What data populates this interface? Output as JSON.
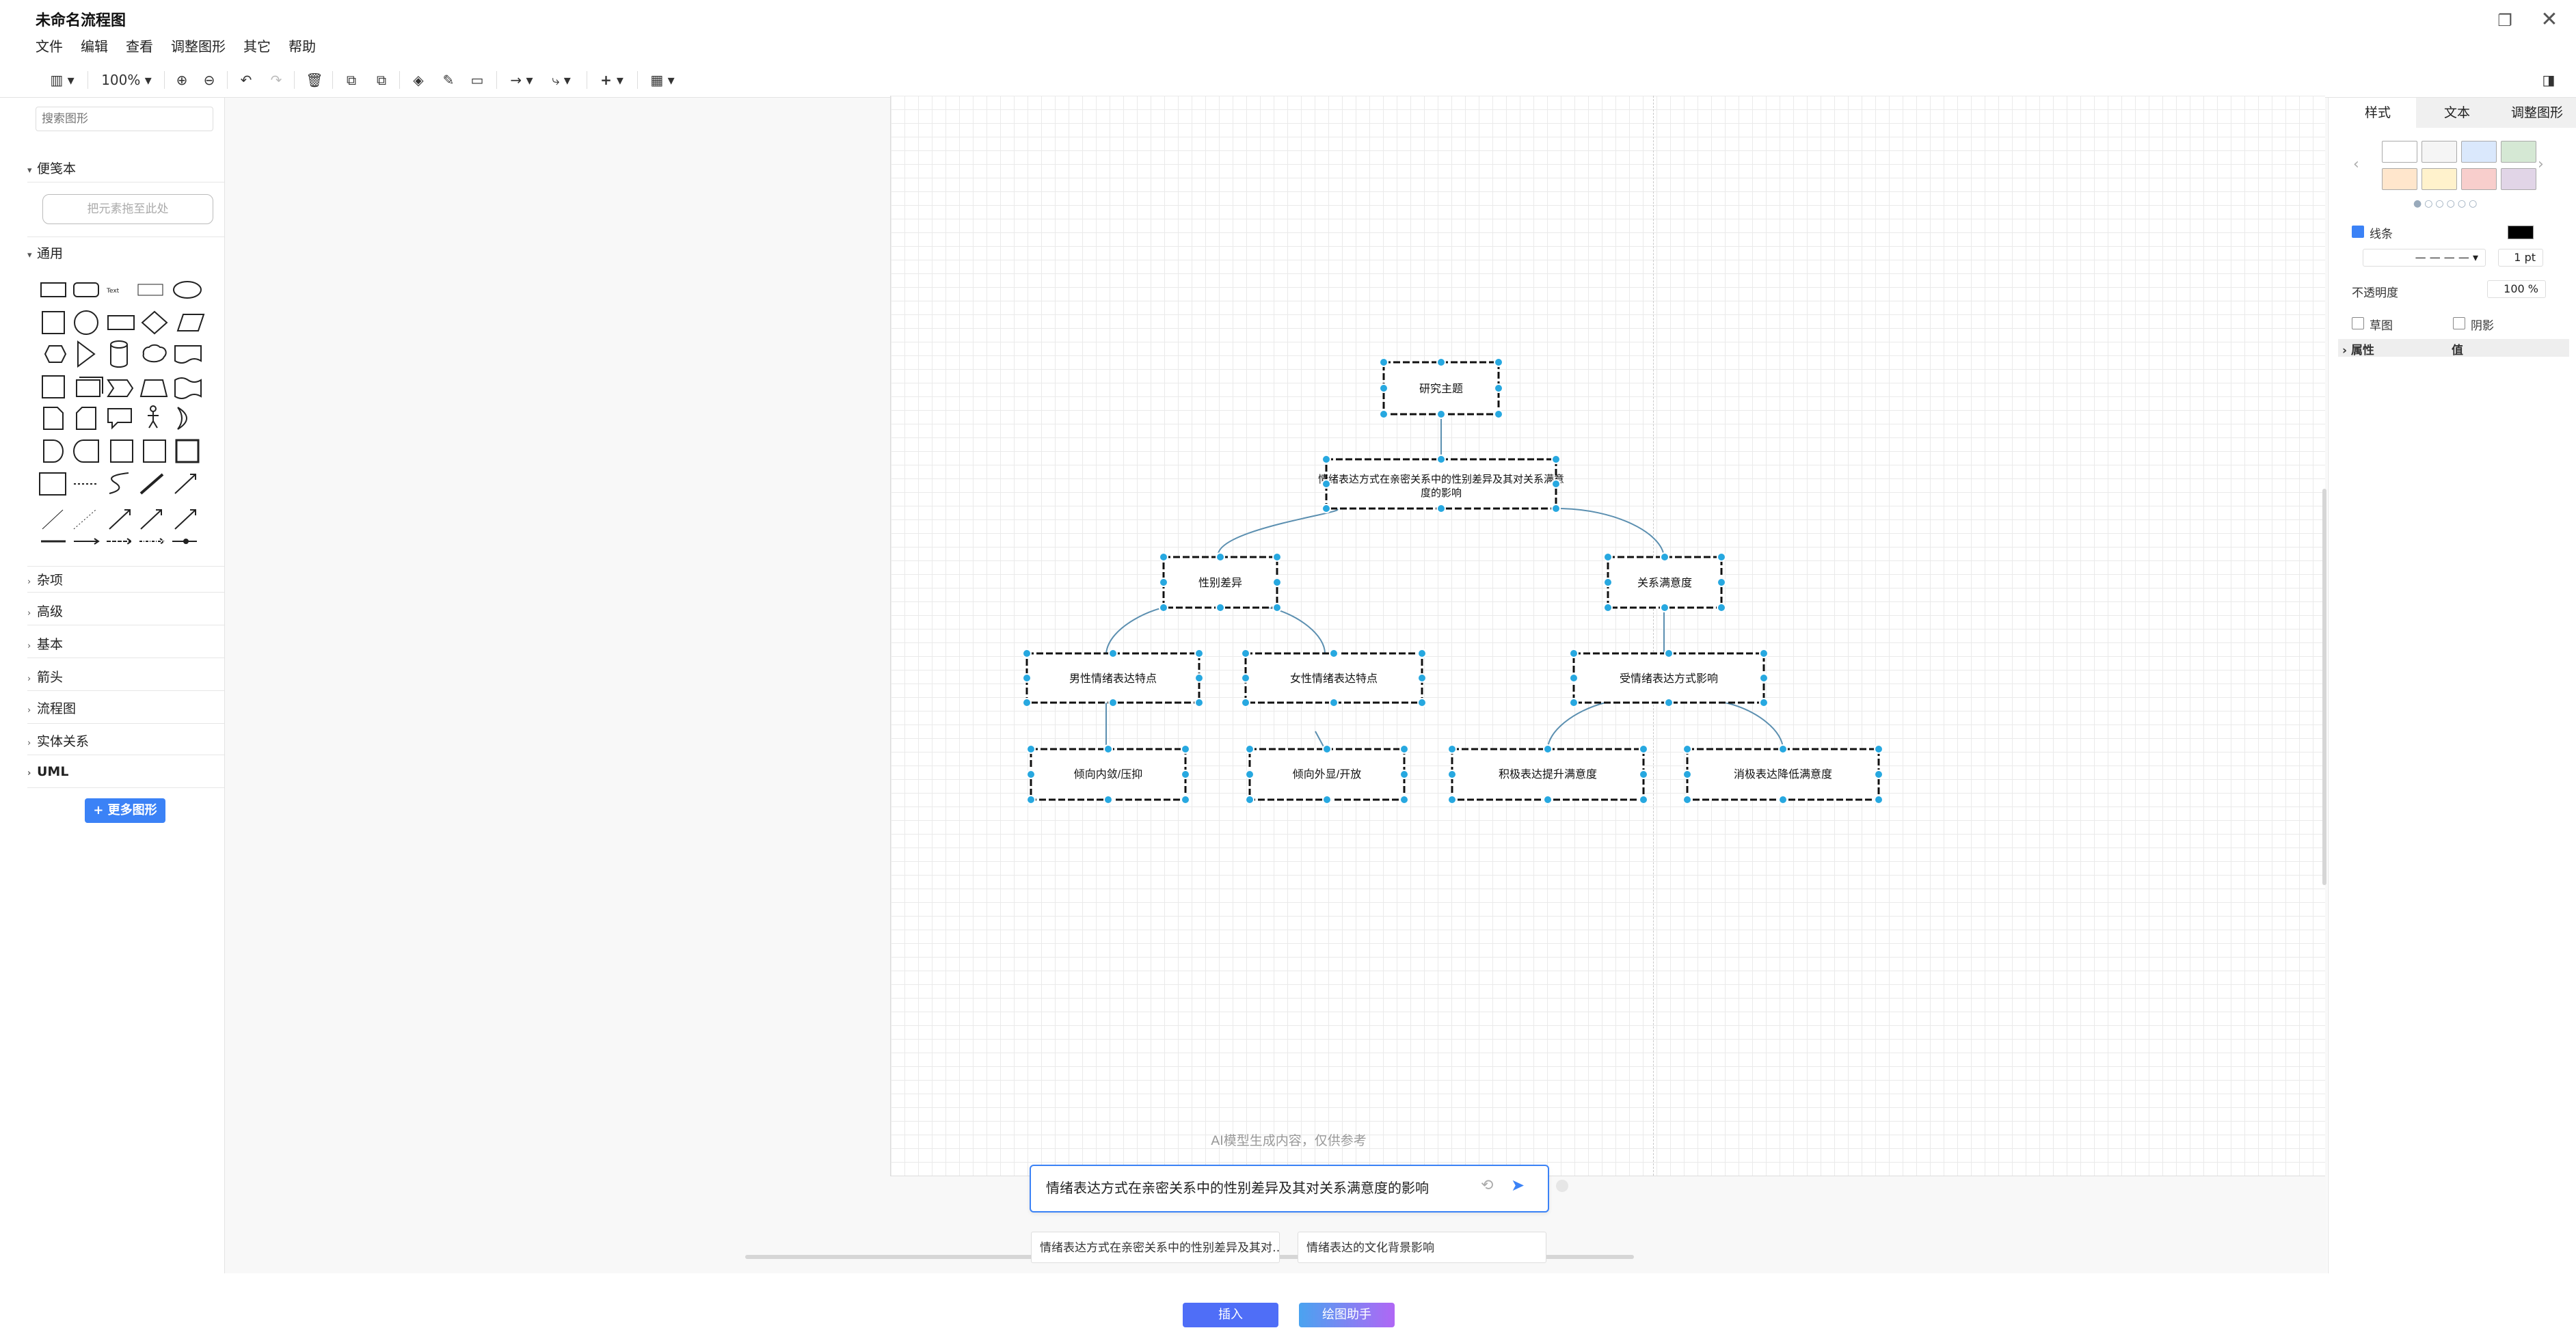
{
  "app": {
    "title": "未命名流程图"
  },
  "menu": [
    "文件",
    "编辑",
    "查看",
    "调整图形",
    "其它",
    "帮助"
  ],
  "toolbar": {
    "zoom": "100%"
  },
  "left_panel": {
    "search_placeholder": "搜索图形",
    "scratchpad": {
      "title": "便笺本",
      "drop_hint": "把元素拖至此处"
    },
    "general": "通用",
    "categories": [
      "杂项",
      "高级",
      "基本",
      "箭头",
      "流程图",
      "实体关系",
      "UML"
    ],
    "more_shapes": "+ 更多图形"
  },
  "diagram": {
    "nodes": {
      "root": "研究主题",
      "topic": "情绪表达方式在亲密关系中的性别差异及其对关系满意度的影响",
      "gender": "性别差异",
      "satisfaction": "关系满意度",
      "male": "男性情绪表达特点",
      "female": "女性情绪表达特点",
      "influence": "受情绪表达方式影响",
      "male_leaf": "倾向内敛/压抑",
      "female_leaf": "倾向外显/开放",
      "positive": "积极表达提升满意度",
      "negative": "消极表达降低满意度"
    }
  },
  "right_panel": {
    "tabs": [
      "样式",
      "文本",
      "调整图形"
    ],
    "line_label": "线条",
    "line_width": "1 pt",
    "opacity_label": "不透明度",
    "opacity_value": "100 %",
    "sketch_label": "草图",
    "shadow_label": "阴影",
    "prop_header": "属性",
    "value_header": "值",
    "swatch_colors": [
      "#ffffff",
      "#f5f5f5",
      "#dae8fc",
      "#d5e8d4",
      "#ffe6cc",
      "#fff2cc",
      "#f8cecc",
      "#e1d5e7"
    ]
  },
  "ai_assistant": {
    "disclaimer": "AI模型生成内容，仅供参考",
    "input_text": "情绪表达方式在亲密关系中的性别差异及其对关系满意度的影响",
    "suggestions": [
      "情绪表达方式在亲密关系中的性别差异及其对…",
      "情绪表达的文化背景影响"
    ],
    "insert_label": "插入",
    "assistant_label": "绘图助手"
  }
}
